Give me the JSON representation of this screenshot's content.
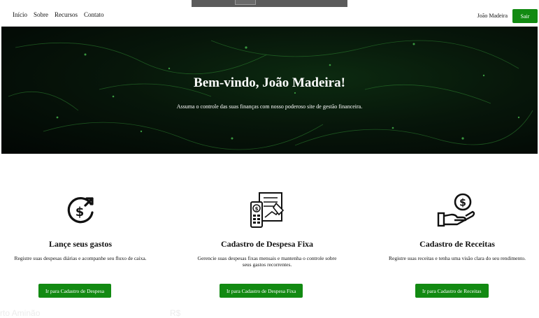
{
  "nav": {
    "links": [
      "Início",
      "Sobre",
      "Recursos",
      "Contato"
    ],
    "user_name": "João Madeira",
    "logout_label": "Sair"
  },
  "hero": {
    "title": "Bem-vindo, João Madeira!",
    "subtitle": "Assuma o controle das suas finanças com nosso poderoso site de gestão financeira."
  },
  "cards": [
    {
      "icon": "dollar-refresh-icon",
      "title": "Lançe seus gastos",
      "description": "Registre suas despesas diárias e acompanhe seu fluxo de caixa.",
      "button": "Ir para Cadastro de Despesa"
    },
    {
      "icon": "invoice-calculator-icon",
      "title": "Cadastro de Despesa Fixa",
      "description": "Gerencie suas despesas fixas mensais e mantenha o controle sobre seus gastos recorrentes.",
      "button": "Ir para Cadastro de Despesa Fixa"
    },
    {
      "icon": "hand-coin-icon",
      "title": "Cadastro de Receitas",
      "description": "Registre suas receitas e tenha uma visão clara do seu rendimento.",
      "button": "Ir para Cadastro de Receitas"
    }
  ],
  "footer_ghost": {
    "left": "rto Aminão",
    "right": "R$"
  },
  "colors": {
    "accent": "#128a12",
    "hero_dark": "#020604"
  }
}
